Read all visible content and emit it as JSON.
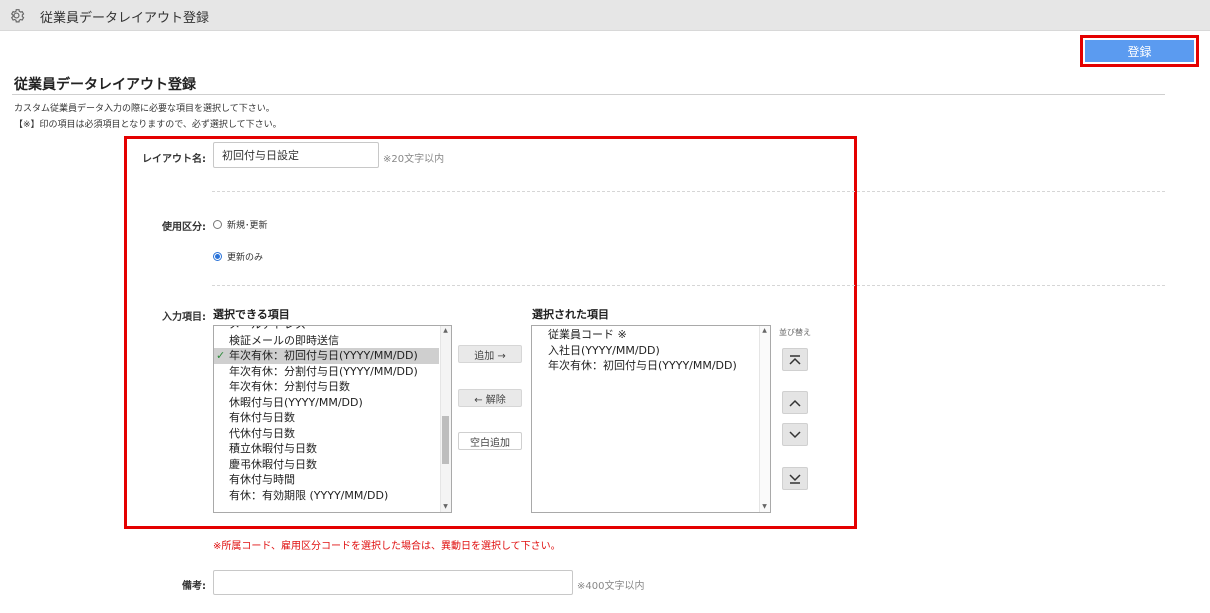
{
  "header": {
    "title": "従業員データレイアウト登録",
    "icon": "gear-icon"
  },
  "toolbar": {
    "register_label": "登録",
    "register_color": "#5b9bf0"
  },
  "page": {
    "title": "従業員データレイアウト登録",
    "description_line1": "カスタム従業員データ入力の際に必要な項目を選択して下さい。",
    "description_line2": "【※】印の項目は必須項目となりますので、必ず選択して下さい。"
  },
  "form": {
    "layout_name_label": "レイアウト名:",
    "layout_name_value": "初回付与日設定",
    "layout_name_hint": "※20文字以内",
    "usage_label": "使用区分:",
    "usage_options": [
      {
        "label": "新規･更新",
        "checked": false
      },
      {
        "label": "更新のみ",
        "checked": true
      }
    ],
    "input_items_label": "入力項目:",
    "available_header": "選択できる項目",
    "selected_header": "選択された項目",
    "available_items": [
      "メールアドレス",
      "検証メールの即時送信",
      "年次有休：初回付与日(YYYY/MM/DD)",
      "年次有休：分割付与日(YYYY/MM/DD)",
      "年次有休：分割付与日数",
      "休暇付与日(YYYY/MM/DD)",
      "有休付与日数",
      "代休付与日数",
      "積立休暇付与日数",
      "慶弔休暇付与日数",
      "有休付与時間",
      "有休：有効期限 (YYYY/MM/DD)"
    ],
    "available_selected_index": 2,
    "selected_items": [
      "従業員コード ※",
      "入社日(YYYY/MM/DD)",
      "年次有休：初回付与日(YYYY/MM/DD)"
    ],
    "add_button": "追加 →",
    "remove_button": "← 解除",
    "blank_add_button": "空白追加",
    "sort_label": "並び替え",
    "sort_buttons": [
      "move-top-icon",
      "move-up-icon",
      "move-down-icon",
      "move-bottom-icon"
    ],
    "warning": "※所属コード、雇用区分コードを選択した場合は、異動日を選択して下さい。",
    "warning_color": "#e01010",
    "memo_label": "備考:",
    "memo_value": "",
    "memo_hint": "※400文字以内"
  },
  "highlight_color": "#e40000"
}
